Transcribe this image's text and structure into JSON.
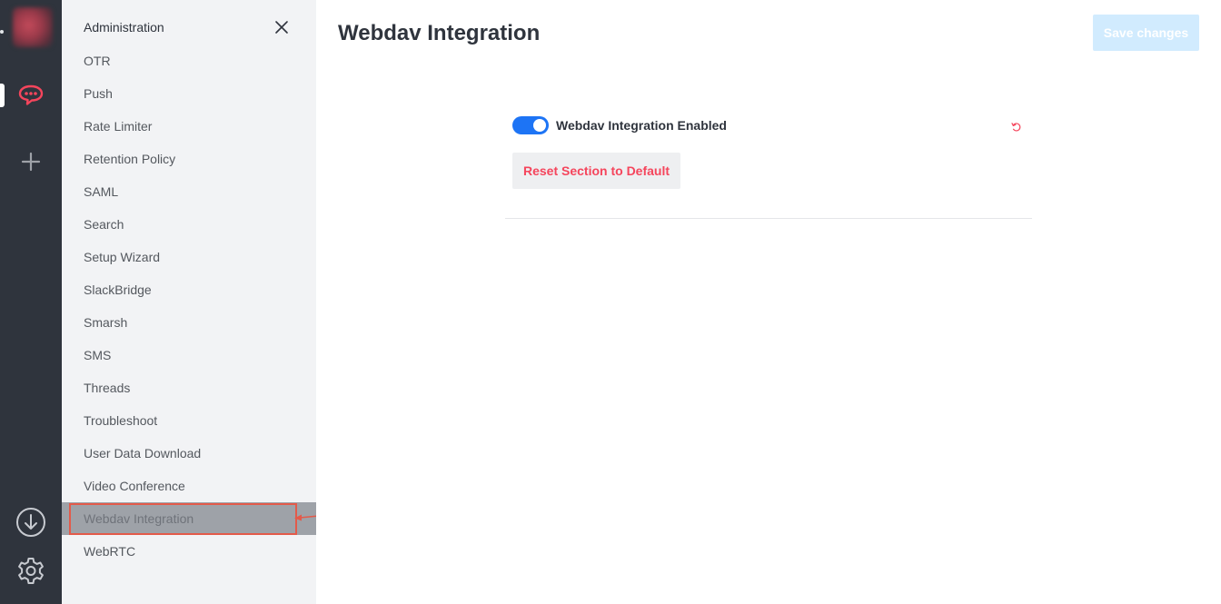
{
  "sidebar": {
    "title": "Administration",
    "items": [
      {
        "label": "OTR"
      },
      {
        "label": "Push"
      },
      {
        "label": "Rate Limiter"
      },
      {
        "label": "Retention Policy"
      },
      {
        "label": "SAML"
      },
      {
        "label": "Search"
      },
      {
        "label": "Setup Wizard"
      },
      {
        "label": "SlackBridge"
      },
      {
        "label": "Smarsh"
      },
      {
        "label": "SMS"
      },
      {
        "label": "Threads"
      },
      {
        "label": "Troubleshoot"
      },
      {
        "label": "User Data Download"
      },
      {
        "label": "Video Conference"
      },
      {
        "label": "Webdav Integration"
      },
      {
        "label": "WebRTC"
      }
    ],
    "active_item": "Webdav Integration"
  },
  "main": {
    "title": "Webdav Integration",
    "save_label": "Save changes",
    "setting": {
      "label": "Webdav Integration Enabled",
      "enabled": true
    },
    "reset_section_label": "Reset Section to Default"
  },
  "rail": {
    "icons": [
      "chat-icon",
      "plus-icon",
      "download-icon",
      "gear-icon"
    ]
  },
  "colors": {
    "accent": "#1d74f5",
    "danger": "#f5455c",
    "rail_bg": "#2f343d",
    "sidebar_bg": "#f2f3f5",
    "highlight": "#e35a4a"
  }
}
